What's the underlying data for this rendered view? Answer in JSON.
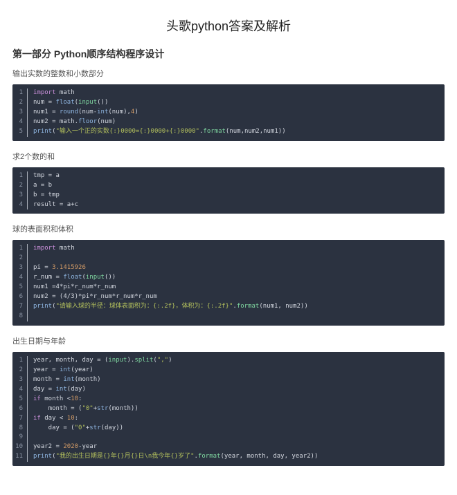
{
  "title": "头歌python答案及解析",
  "section1": "第一部分 Python顺序结构程序设计",
  "sub1": "输出实数的整数和小数部分",
  "code1": {
    "l1_kw": "import",
    "l1_mod": " math",
    "l2_a": "num = ",
    "l2_fn": "float",
    "l2_b": "(",
    "l2_bi": "input",
    "l2_c": "())",
    "l3_a": "num1 = ",
    "l3_fn": "round",
    "l3_b": "(num-",
    "l3_fn2": "int",
    "l3_c": "(num),",
    "l3_n": "4",
    "l3_d": ")",
    "l4_a": "num2 = math.",
    "l4_fn": "floor",
    "l4_b": "(num)",
    "l5_fn": "print",
    "l5_a": "(",
    "l5_s": "\"输入一个正的实数{:}0000={:}0000+{:}0000\"",
    "l5_b": ".",
    "l5_bi": "format",
    "l5_c": "(num,num2,num1))"
  },
  "sub2": "求2个数的和",
  "code2": {
    "l1": "tmp = a",
    "l2": "a = b",
    "l3": "b = tmp",
    "l4": "result = a+c"
  },
  "sub3": "球的表面积和体积",
  "code3": {
    "l1_kw": "import",
    "l1_mod": " math",
    "l3_a": "pi = ",
    "l3_n": "3.1415926",
    "l4_a": "r_num = ",
    "l4_fn": "float",
    "l4_b": "(",
    "l4_bi": "input",
    "l4_c": "())",
    "l5": "num1 =4*pi*r_num*r_num",
    "l6": "num2 = (4/3)*pi*r_num*r_num*r_num",
    "l7_fn": "print",
    "l7_a": "(",
    "l7_s": "\"请输入球的半径：球体表面积为：{:.2f}，体积为：{:.2f}\"",
    "l7_b": ".",
    "l7_bi": "format",
    "l7_c": "(num1, num2))"
  },
  "sub4": "出生日期与年龄",
  "code4": {
    "l1_a": "year, month, day = (",
    "l1_bi": "input",
    "l1_b": ").",
    "l1_sp": "split",
    "l1_c": "(",
    "l1_s": "\",\"",
    "l1_d": ")",
    "l2_a": "year = ",
    "l2_fn": "int",
    "l2_b": "(year)",
    "l3_a": "month = ",
    "l3_fn": "int",
    "l3_b": "(month)",
    "l4_a": "day = ",
    "l4_fn": "int",
    "l4_b": "(day)",
    "l5_kw": "if",
    "l5_a": " month <",
    "l5_n": "10",
    "l5_b": ":",
    "l6_a": "    month = (",
    "l6_s": "\"0\"",
    "l6_b": "+",
    "l6_fn": "str",
    "l6_c": "(month))",
    "l7_kw": "if",
    "l7_a": " day < ",
    "l7_n": "10",
    "l7_b": ":",
    "l8_a": "    day = (",
    "l8_s": "\"0\"",
    "l8_b": "+",
    "l8_fn": "str",
    "l8_c": "(day))",
    "l10_a": "year2 = ",
    "l10_n": "2020",
    "l10_b": "-year",
    "l11_fn": "print",
    "l11_a": "(",
    "l11_s": "\"我的出生日期是{}年{}月{}日\\n我今年{}岁了\"",
    "l11_b": ".",
    "l11_bi": "format",
    "l11_c": "(year, month, day, year2))"
  }
}
